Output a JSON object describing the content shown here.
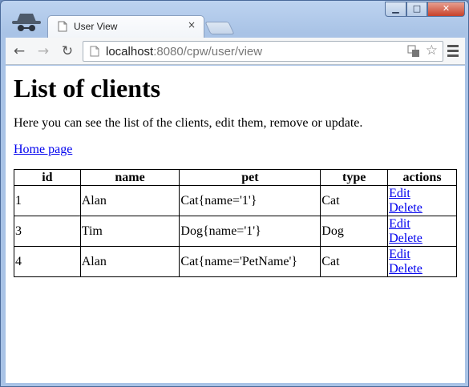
{
  "browser": {
    "tab_title": "User View",
    "tab_close": "×",
    "url_host": "localhost",
    "url_rest": ":8080/cpw/user/view",
    "window_buttons": {
      "minimize": "▁",
      "maximize": "□",
      "close": "✕"
    }
  },
  "page": {
    "title": "List of clients",
    "description": "Here you can see the list of the clients, edit them, remove or update.",
    "home_link": "Home page",
    "table": {
      "headers": [
        "id",
        "name",
        "pet",
        "type",
        "actions"
      ],
      "rows": [
        {
          "id": "1",
          "name": "Alan",
          "pet": "Cat{name='1'}",
          "type": "Cat",
          "edit": "Edit",
          "delete": "Delete"
        },
        {
          "id": "3",
          "name": "Tim",
          "pet": "Dog{name='1'}",
          "type": "Dog",
          "edit": "Edit",
          "delete": "Delete"
        },
        {
          "id": "4",
          "name": "Alan",
          "pet": "Cat{name='PetName'}",
          "type": "Cat",
          "edit": "Edit",
          "delete": "Delete"
        }
      ]
    }
  }
}
